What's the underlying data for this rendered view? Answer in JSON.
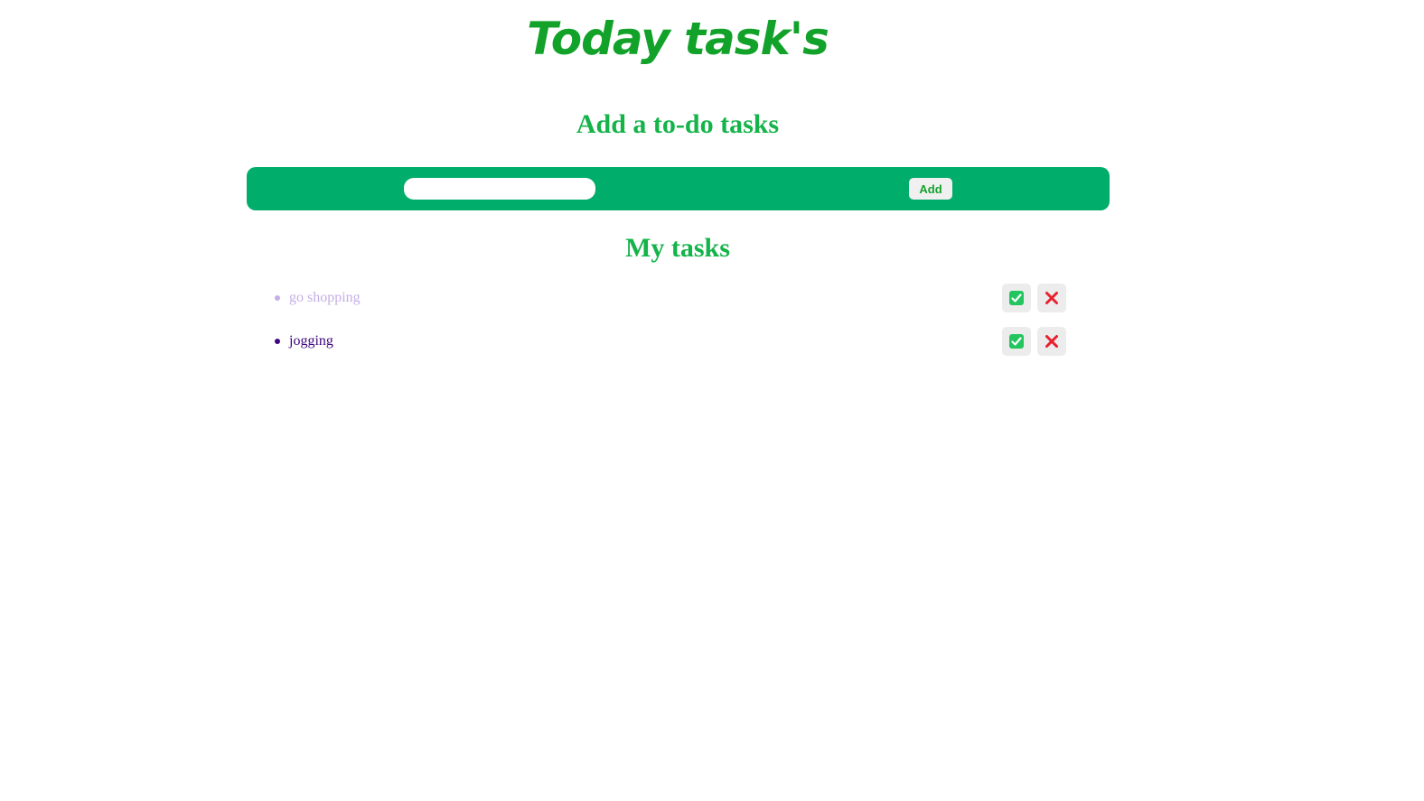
{
  "header": {
    "title": "Today task's"
  },
  "add_section": {
    "title": "Add a to-do tasks",
    "input_value": "",
    "add_label": "Add"
  },
  "list_section": {
    "title": "My tasks"
  },
  "tasks": [
    {
      "text": "go shopping",
      "status": "done"
    },
    {
      "text": "jogging",
      "status": "pending"
    }
  ],
  "icons": {
    "done": "check-mark-icon",
    "delete": "cross-mark-icon"
  },
  "colors": {
    "brand_green": "#00ad6b",
    "title_green": "#12a22a",
    "done_text": "#c6aee6",
    "pending_text": "#3e0680",
    "delete_red": "#e8202f"
  }
}
